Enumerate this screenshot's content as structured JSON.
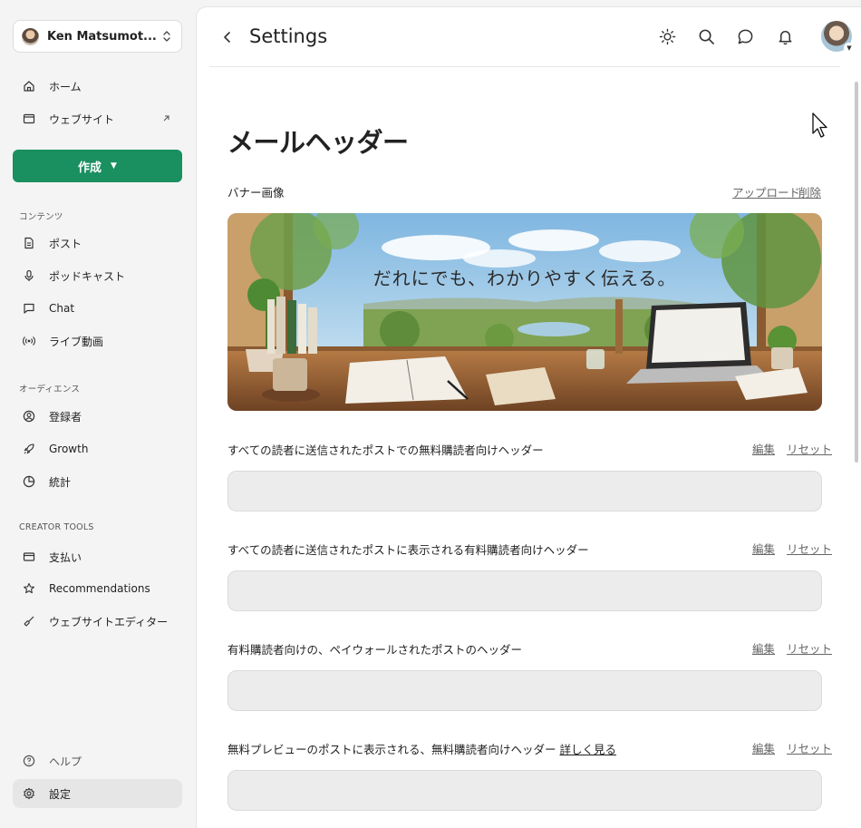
{
  "account": {
    "name": "Ken Matsumot..."
  },
  "sidebar": {
    "top_items": [
      {
        "label": "ホーム"
      },
      {
        "label": "ウェブサイト"
      }
    ],
    "create_label": "作成",
    "sections": [
      {
        "heading": "コンテンツ",
        "items": [
          {
            "label": "ポスト"
          },
          {
            "label": "ポッドキャスト"
          },
          {
            "label": "Chat"
          },
          {
            "label": "ライブ動画"
          }
        ]
      },
      {
        "heading": "オーディエンス",
        "items": [
          {
            "label": "登録者"
          },
          {
            "label": "Growth"
          },
          {
            "label": "統計"
          }
        ]
      },
      {
        "heading": "CREATOR TOOLS",
        "items": [
          {
            "label": "支払い"
          },
          {
            "label": "Recommendations"
          },
          {
            "label": "ウェブサイトエディター"
          }
        ]
      }
    ],
    "bottom_items": [
      {
        "label": "ヘルプ"
      },
      {
        "label": "設定"
      }
    ]
  },
  "header": {
    "title": "Settings"
  },
  "content": {
    "title": "メールヘッダー",
    "banner": {
      "label": "バナー画像",
      "upload": "アップロード",
      "delete": "削除",
      "image_text": "だれにでも、わかりやすく伝える。"
    },
    "rows": [
      {
        "label": "すべての読者に送信されたポストでの無料購読者向けヘッダー",
        "edit": "編集",
        "reset": "リセット"
      },
      {
        "label": "すべての読者に送信されたポストに表示される有料購読者向けヘッダー",
        "edit": "編集",
        "reset": "リセット"
      },
      {
        "label": "有料購読者向けの、ペイウォールされたポストのヘッダー",
        "edit": "編集",
        "reset": "リセット"
      },
      {
        "label": "無料プレビューのポストに表示される、無料購読者向けヘッダー",
        "more": "詳しく見る",
        "edit": "編集",
        "reset": "リセット"
      }
    ]
  },
  "colors": {
    "accent": "#1a8f60",
    "field_bg": "#ececec",
    "sidebar_bg": "#f4f4f4"
  }
}
